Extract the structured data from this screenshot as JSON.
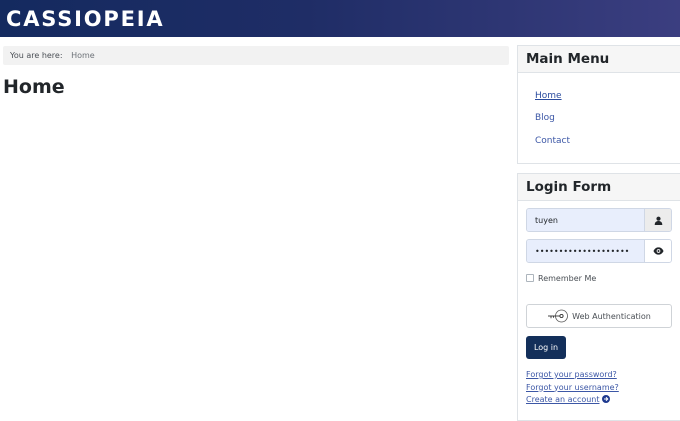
{
  "header": {
    "brand": "CASSIOPEIA"
  },
  "breadcrumb": {
    "label": "You are here:",
    "current": "Home"
  },
  "main": {
    "title": "Home"
  },
  "menu_module": {
    "title": "Main Menu",
    "items": [
      {
        "label": "Home",
        "active": true
      },
      {
        "label": "Blog",
        "active": false
      },
      {
        "label": "Contact",
        "active": false
      }
    ]
  },
  "login_module": {
    "title": "Login Form",
    "username": {
      "value": "tuyen",
      "icon": "user-icon"
    },
    "password": {
      "value": "••••••••••••••••••••",
      "icon": "eye-icon"
    },
    "remember_label": "Remember Me",
    "webauthn_label": "Web Authentication",
    "login_label": "Log in",
    "links": {
      "forgot_password": "Forgot your password?",
      "forgot_username": "Forgot your username?",
      "create_account": "Create an account"
    }
  },
  "colors": {
    "header_start": "#142a5f",
    "header_end": "#3b3e80",
    "link": "#3c57a6",
    "login_button": "#132f5a",
    "input_bg": "#e8eefc"
  }
}
